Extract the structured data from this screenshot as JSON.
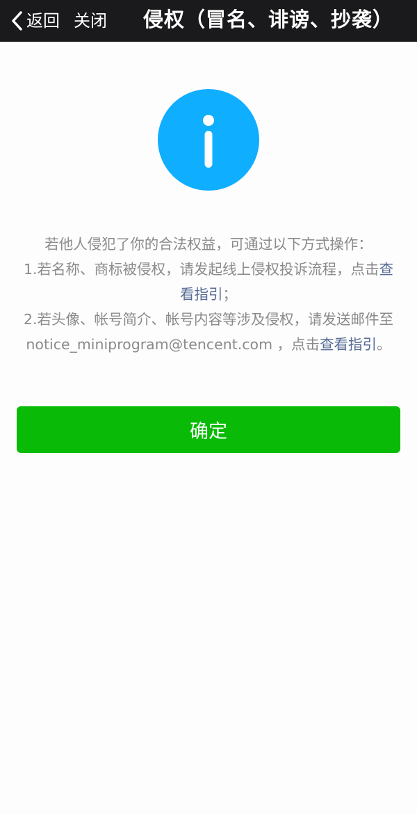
{
  "nav": {
    "back_label": "返回",
    "close_label": "关闭",
    "title": "侵权（冒名、诽谤、抄袭）"
  },
  "info_icon": {
    "icon": "info-icon",
    "color": "#10aeff"
  },
  "message": {
    "intro": "若他人侵犯了你的合法权益，可通过以下方式操作：",
    "item1_text": "1.若名称、商标被侵权，请发起线上侵权投诉流程，点击",
    "item1_link": "查看指引",
    "item1_end": "；",
    "item2_text": "2.若头像、帐号简介、帐号内容等涉及侵权，请发送邮件至notice_miniprogram@tencent.com ，点击",
    "item2_link": "查看指引",
    "item2_end": "。"
  },
  "confirm_label": "确定",
  "colors": {
    "nav_background": "#1a1a1c",
    "primary_button": "#09bb07",
    "link": "#576b95",
    "body_text": "#8a8a8a"
  }
}
